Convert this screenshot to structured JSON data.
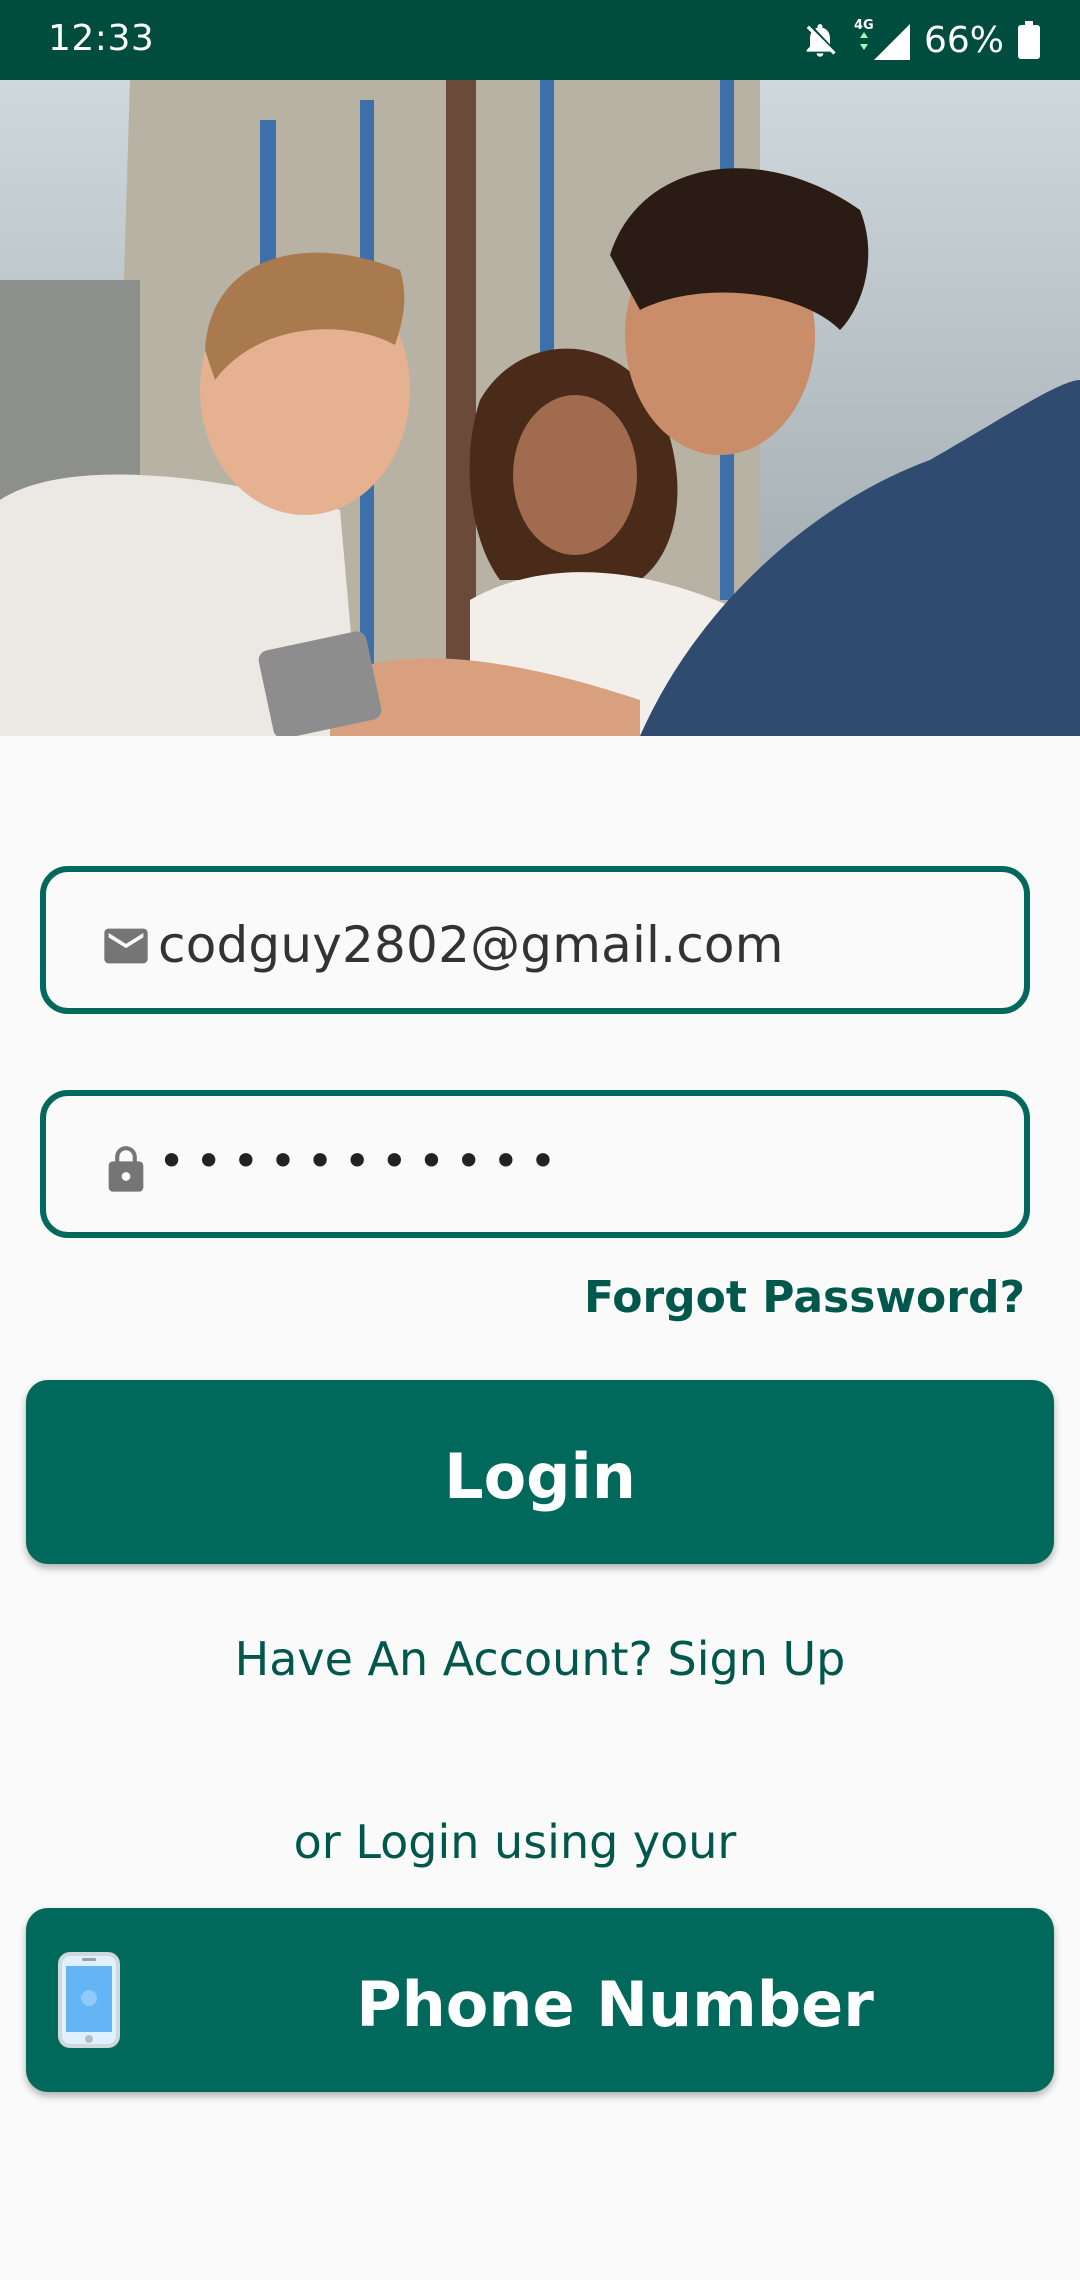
{
  "status_bar": {
    "time": "12:33",
    "network": "4G",
    "battery": "66%",
    "icons": [
      "notifications-off-icon",
      "signal-icon",
      "battery-icon"
    ]
  },
  "hero": {
    "image": "photo-three-people-looking-at-phone"
  },
  "form": {
    "email_icon": "email-icon",
    "email_value": "codguy2802@gmail.com",
    "password_icon": "lock-icon",
    "password_value": "•••••••••••",
    "forgot_password": "Forgot Password?",
    "login_button": "Login",
    "signup_link": "Have An Account? Sign Up",
    "alt_login_text": "or Login using your",
    "phone_button": "Phone Number",
    "phone_icon": "smartphone-icon"
  },
  "colors": {
    "primary": "#00695c",
    "status_bar": "#004d40",
    "text_accent": "#00574b",
    "background": "#fafafa"
  }
}
